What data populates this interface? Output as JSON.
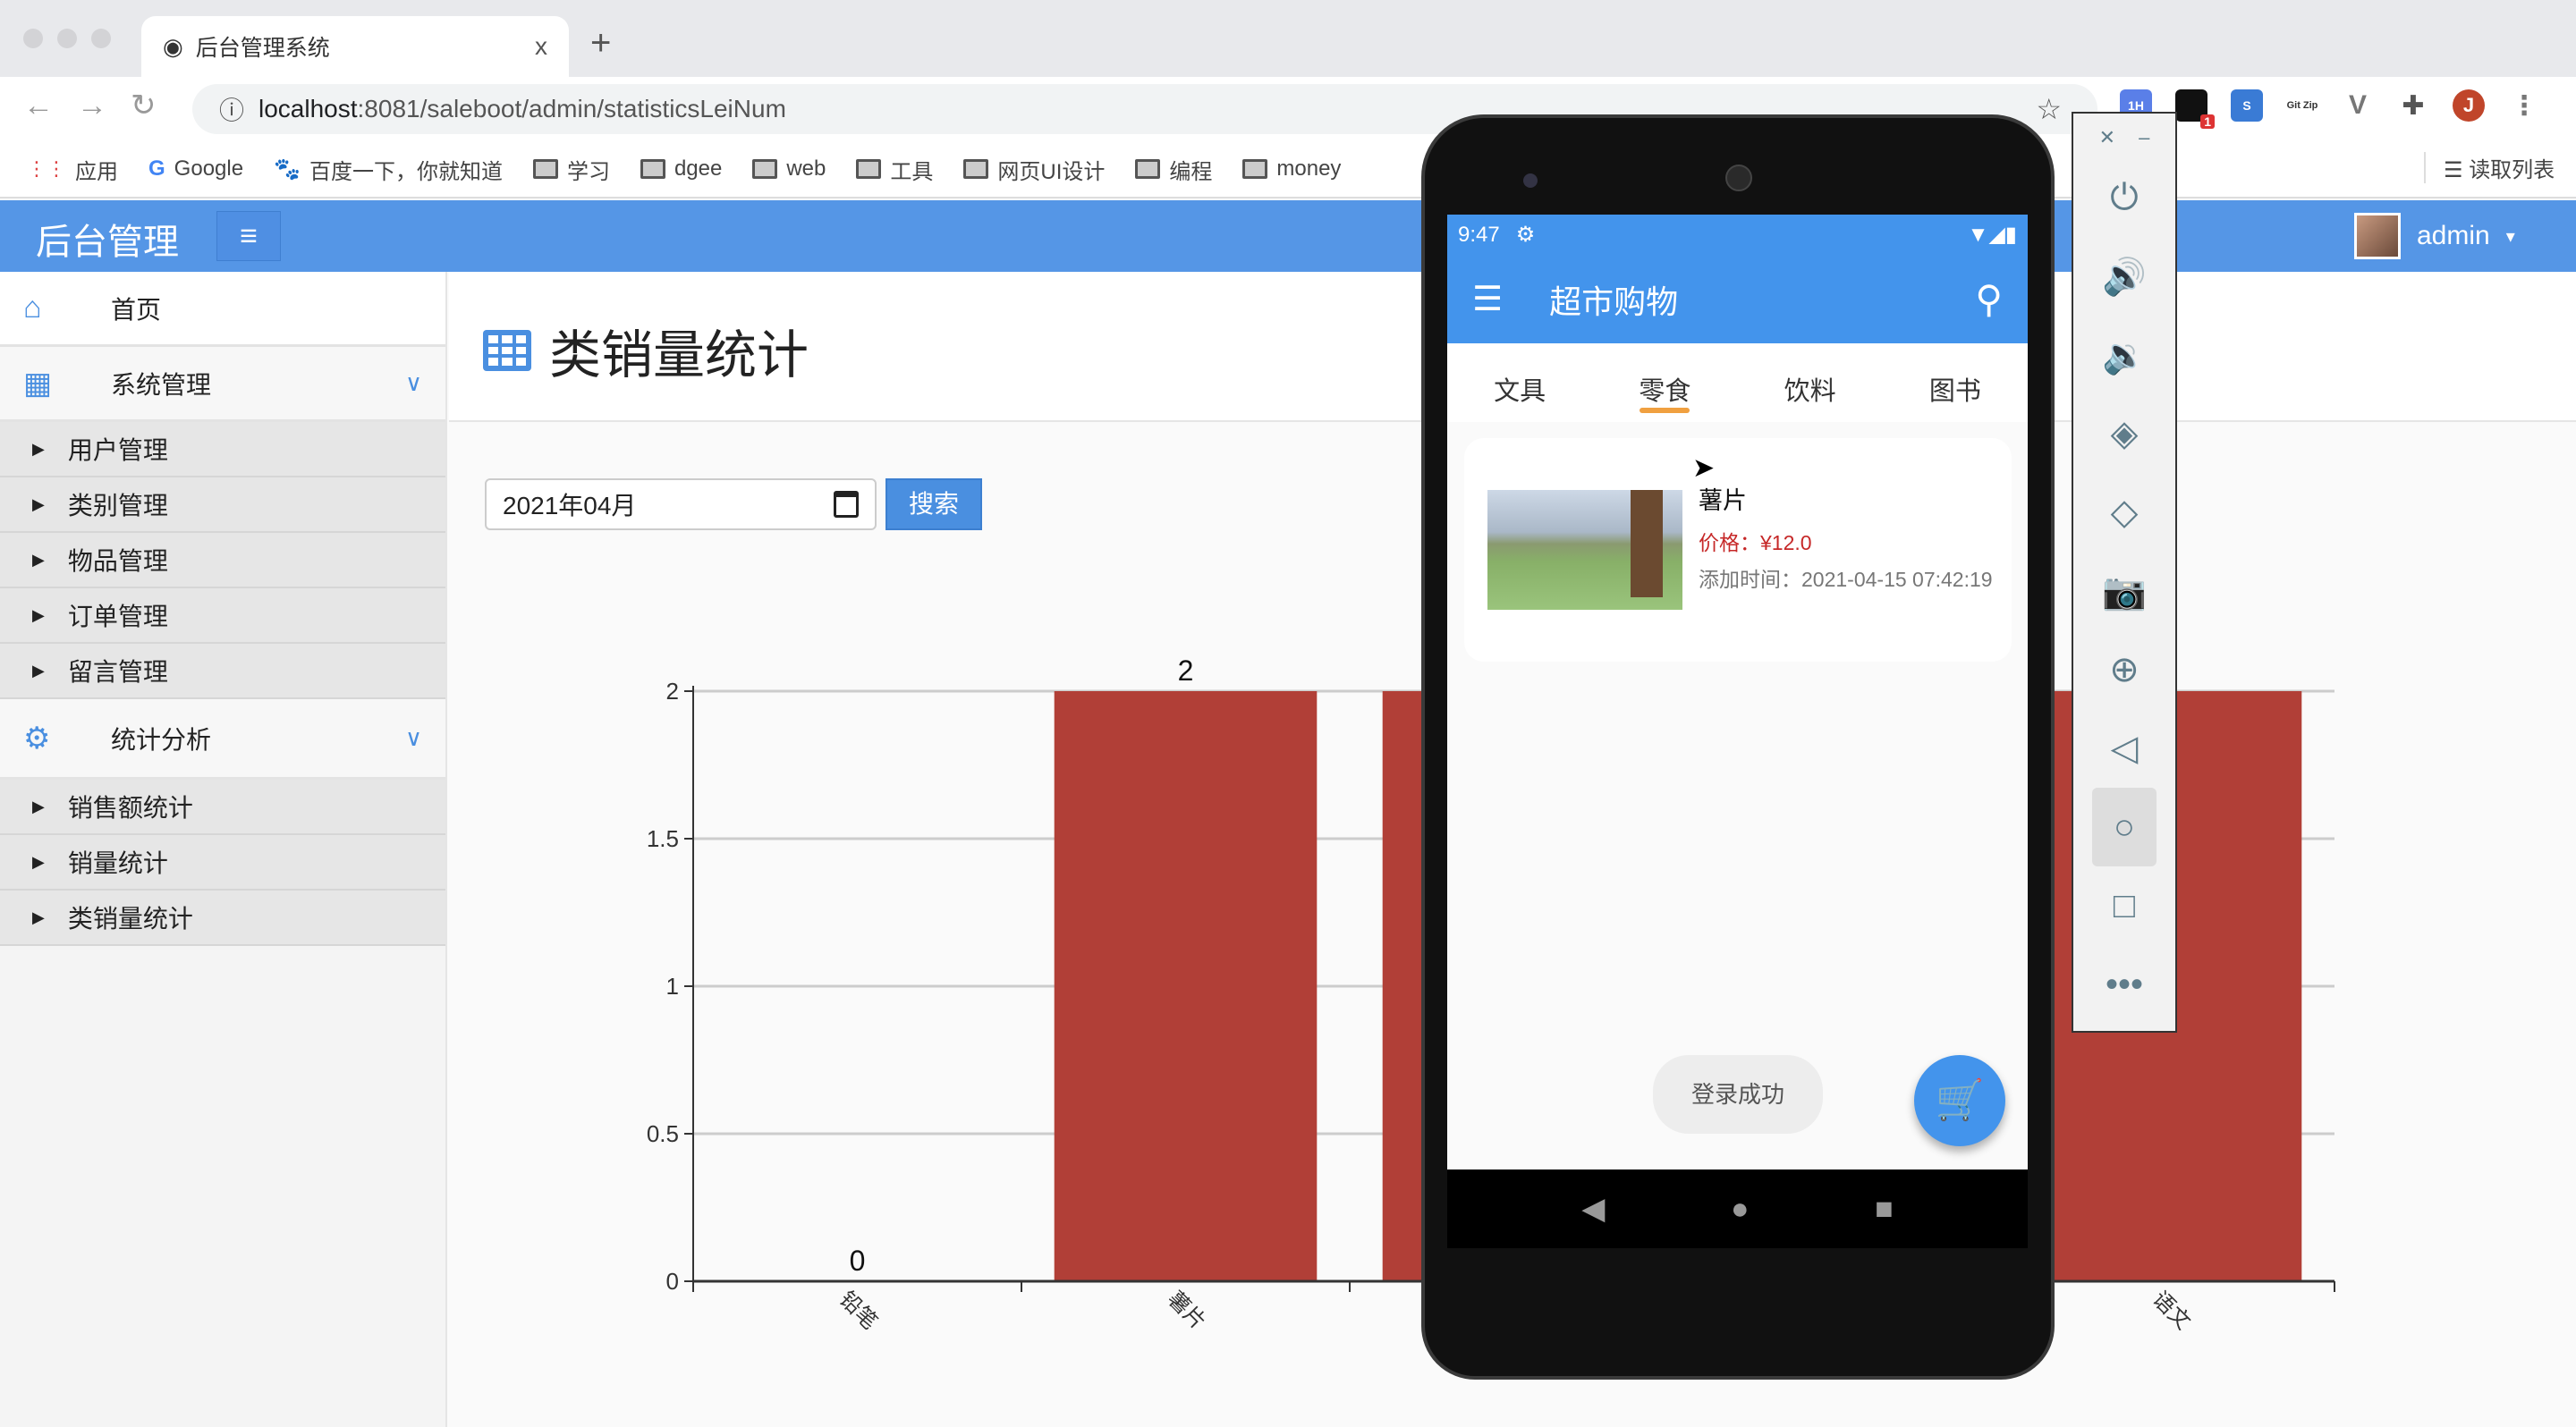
{
  "browser": {
    "tab_title": "后台管理系统",
    "tab_close": "x",
    "new_tab": "+",
    "url_host": "localhost",
    "url_rest": ":8081/saleboot/admin/statisticsLeiNum",
    "bookmarks": [
      "应用",
      "Google",
      "百度一下，你就知道",
      "学习",
      "dgee",
      "web",
      "工具",
      "网页UI设计",
      "编程",
      "money"
    ],
    "reading_list": "读取列表",
    "profile_initial": "J",
    "extension_badge": "1",
    "ext_gitzip": "Git Zip"
  },
  "header": {
    "brand": "后台管理",
    "menu_icon": "≡",
    "user": "admin",
    "user_caret": "▾"
  },
  "sidebar": {
    "home": "首页",
    "groups": [
      {
        "label": "系统管理",
        "items": [
          "用户管理",
          "类别管理",
          "物品管理",
          "订单管理",
          "留言管理"
        ]
      },
      {
        "label": "统计分析",
        "items": [
          "销售额统计",
          "销量统计",
          "类销量统计"
        ]
      }
    ]
  },
  "main": {
    "title": "类销量统计",
    "date_value": "2021年04月",
    "search_label": "搜索"
  },
  "chart_data": {
    "type": "bar",
    "categories": [
      "铅笔",
      "薯片",
      "",
      "",
      "语文"
    ],
    "values": [
      0,
      2,
      2,
      null,
      2
    ],
    "data_labels": [
      "0",
      "2",
      "",
      "",
      ""
    ],
    "yticks": [
      "0",
      "0.5",
      "1",
      "1.5",
      "2"
    ],
    "ylim": [
      0,
      2
    ],
    "grid": true,
    "bar_color": "#b13f37"
  },
  "phone": {
    "time": "9:47",
    "app_title": "超市购物",
    "tabs": [
      "文具",
      "零食",
      "饮料",
      "图书"
    ],
    "active_tab": 1,
    "product": {
      "name": "薯片",
      "price": "价格：¥12.0",
      "added": "添加时间：2021-04-15 07:42:19"
    },
    "toast": "登录成功",
    "accent": "#4394ec"
  }
}
